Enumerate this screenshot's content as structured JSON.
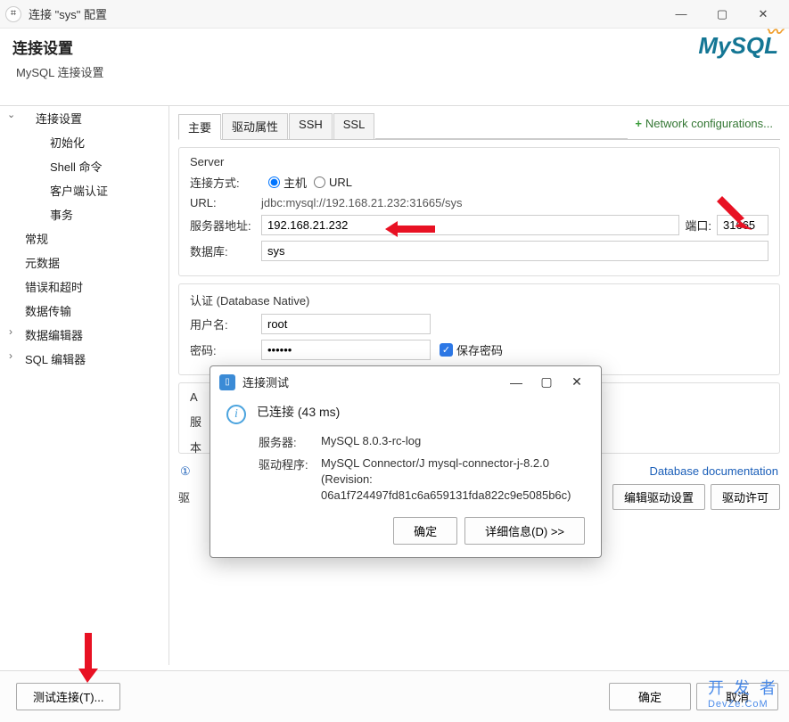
{
  "window": {
    "title": "连接 \"sys\" 配置"
  },
  "header": {
    "title": "连接设置",
    "subtitle": "MySQL 连接设置",
    "logo": "MySQL"
  },
  "sidebar": {
    "items": [
      {
        "label": "连接设置",
        "kind": "expand top"
      },
      {
        "label": "初始化",
        "kind": "child"
      },
      {
        "label": "Shell 命令",
        "kind": "child"
      },
      {
        "label": "客户端认证",
        "kind": "child"
      },
      {
        "label": "事务",
        "kind": "child"
      },
      {
        "label": "常规",
        "kind": ""
      },
      {
        "label": "元数据",
        "kind": ""
      },
      {
        "label": "错误和超时",
        "kind": ""
      },
      {
        "label": "数据传输",
        "kind": ""
      },
      {
        "label": "数据编辑器",
        "kind": "collapse"
      },
      {
        "label": "SQL 编辑器",
        "kind": "collapse"
      }
    ]
  },
  "tabs": {
    "items": [
      "主要",
      "驱动属性",
      "SSH",
      "SSL"
    ],
    "network": "Network configurations..."
  },
  "server": {
    "group_title": "Server",
    "connect_mode_label": "连接方式:",
    "host_label": "主机",
    "url_option_label": "URL",
    "url_label": "URL:",
    "url_value": "jdbc:mysql://192.168.21.232:31665/sys",
    "server_addr_label": "服务器地址:",
    "server_addr_value": "192.168.21.232",
    "port_label": "端口:",
    "port_value": "31665",
    "db_label": "数据库:",
    "db_value": "sys"
  },
  "auth": {
    "group_title": "认证 (Database Native)",
    "user_label": "用户名:",
    "user_value": "root",
    "pass_label": "密码:",
    "pass_value": "••••••",
    "save_pass_label": "保存密码"
  },
  "advanced": {
    "prefix": "A",
    "server_prefix": "服",
    "local_prefix": "本"
  },
  "links": {
    "driver_info": "① ",
    "db_doc": "Database documentation"
  },
  "driver_buttons": {
    "label_prefix": "驱",
    "edit": "编辑驱动设置",
    "license": "驱动许可"
  },
  "footer": {
    "test": "测试连接(T)...",
    "ok": "确定",
    "cancel": "取消"
  },
  "modal": {
    "title": "连接测试",
    "connected": "已连接 (43 ms)",
    "server_label": "服务器:",
    "server_val": "MySQL 8.0.3-rc-log",
    "driver_label": "驱动程序:",
    "driver_val": "MySQL Connector/J mysql-connector-j-8.2.0 (Revision: 06a1f724497fd81c6a659131fda822c9e5085b6c)",
    "ok": "确定",
    "details": "详细信息(D) >>"
  },
  "watermark": {
    "main": "开 发 者",
    "sub": "DevZe.CoM"
  }
}
